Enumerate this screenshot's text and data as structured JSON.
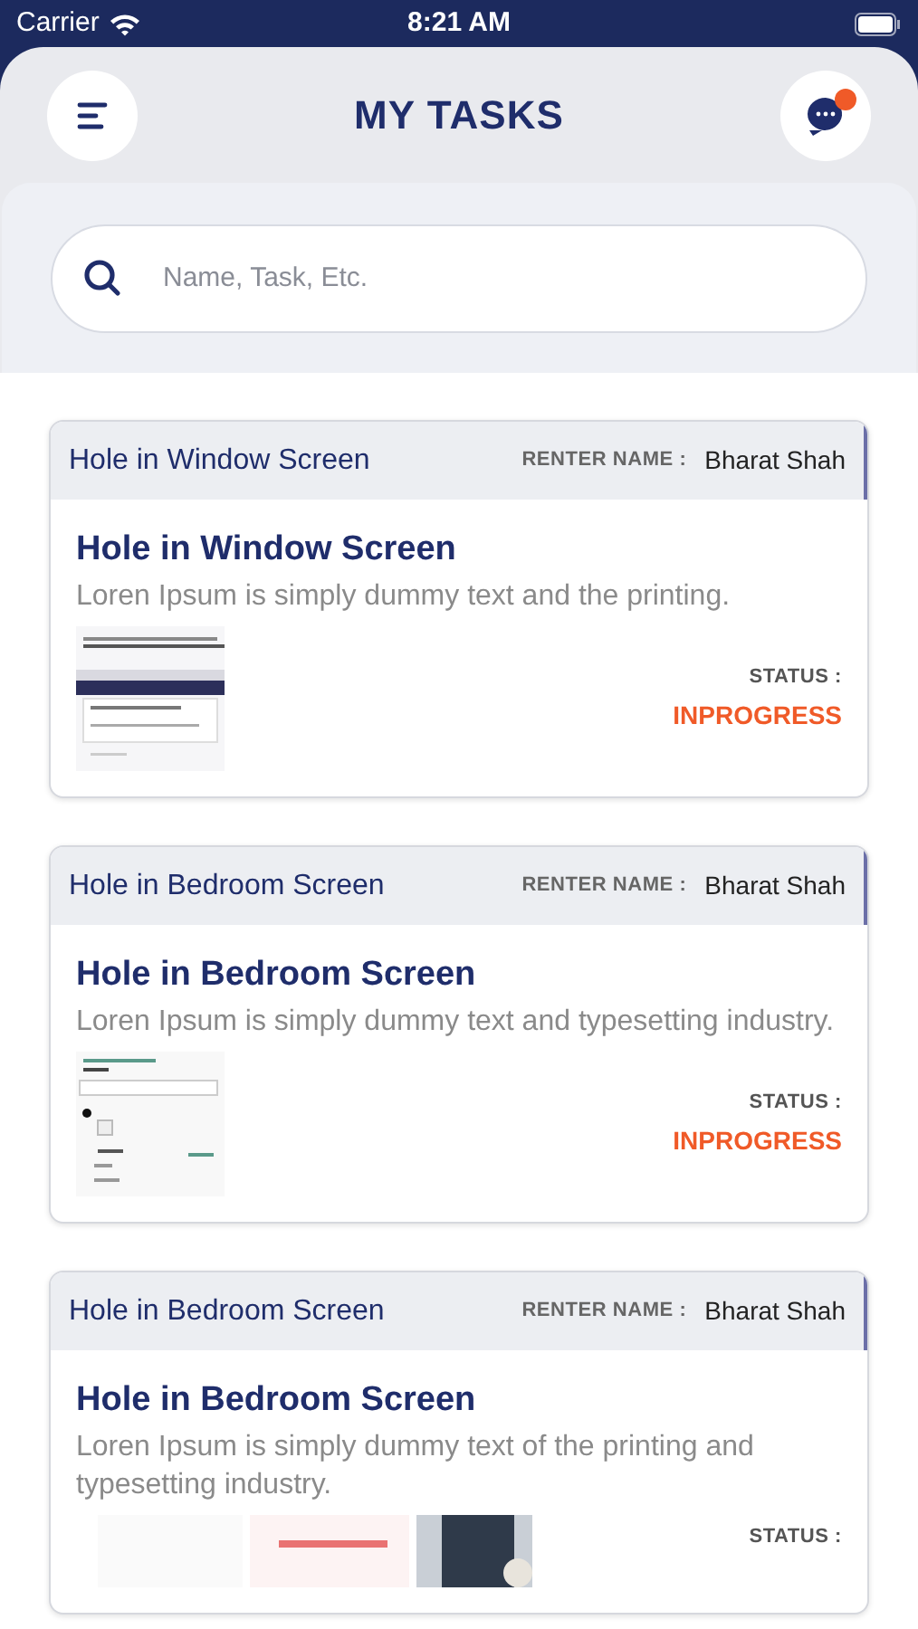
{
  "status_bar": {
    "carrier": "Carrier",
    "time": "8:21 AM"
  },
  "header": {
    "title": "MY TASKS",
    "has_notification": true
  },
  "search": {
    "placeholder": "Name, Task, Etc."
  },
  "tasks": [
    {
      "header_title": "Hole in Window Screen",
      "renter_label": "RENTER NAME :",
      "renter_name": "Bharat Shah",
      "title": "Hole in Window Screen",
      "description": "Loren Ipsum is simply dummy text and the printing.",
      "status_label": "STATUS :",
      "status": "INPROGRESS"
    },
    {
      "header_title": "Hole in Bedroom Screen",
      "renter_label": "RENTER NAME :",
      "renter_name": "Bharat Shah",
      "title": "Hole in Bedroom Screen",
      "description": "Loren Ipsum is simply dummy text and typesetting industry.",
      "status_label": "STATUS :",
      "status": "INPROGRESS"
    },
    {
      "header_title": "Hole in Bedroom Screen",
      "renter_label": "RENTER NAME :",
      "renter_name": "Bharat Shah",
      "title": "Hole in Bedroom Screen",
      "description": "Loren Ipsum is simply dummy text of the printing and typesetting industry.",
      "status_label": "STATUS :"
    }
  ]
}
